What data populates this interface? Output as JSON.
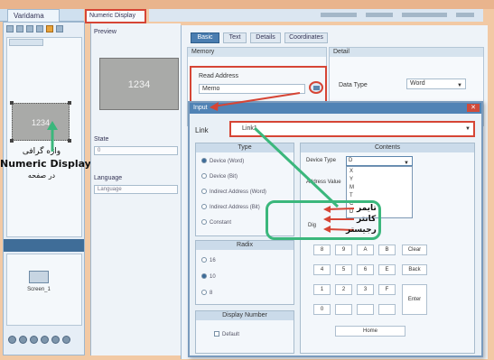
{
  "left_tab": "Varidama",
  "numeric_tab": "Numeric Display",
  "left_pane": {
    "widget_value": "1234",
    "annotation": [
      "واژه گرافی",
      "Numeric Display",
      "در صفحه"
    ],
    "thumb_label": "Screen_1"
  },
  "props": {
    "preview_label": "Preview",
    "preview_value": "1234",
    "fields": [
      {
        "label": "State",
        "value": "0"
      },
      {
        "label": "Language",
        "value": "Language"
      }
    ]
  },
  "dialog": {
    "tabs": [
      "Basic",
      "Text",
      "Details",
      "Coordinates"
    ],
    "memory_label": "Memory",
    "read_address_label": "Read Address",
    "read_address_value": "Memo",
    "detail_label": "Detail",
    "data_type_label": "Data Type",
    "data_type_value": "Word"
  },
  "input_dialog": {
    "title": "Input",
    "link_label": "Link",
    "link_value": "Link1",
    "type_title": "Type",
    "type_options": [
      "Device (Word)",
      "Device (Bit)",
      "Indirect Address (Word)",
      "Indirect Address (Bit)",
      "Constant"
    ],
    "radix_title": "Radix",
    "radix_options": [
      "16",
      "10",
      "8"
    ],
    "format_title": "Display Number",
    "default_label": "Default",
    "contents_title": "Contents",
    "device_type_label": "Device Type",
    "device_type_value": "D",
    "device_list": [
      "X",
      "Y",
      "M",
      "T",
      "C",
      "D"
    ],
    "address_label": "Address Value",
    "decimal_label": "Dig",
    "keys": [
      [
        "8",
        "9",
        "A",
        "B",
        "Clear"
      ],
      [
        "4",
        "5",
        "6",
        "E",
        "Back"
      ],
      [
        "1",
        "2",
        "3",
        "F",
        ""
      ],
      [
        "0",
        "",
        "",
        "",
        ""
      ]
    ],
    "key_enter": "Enter",
    "key_home": "Home"
  },
  "annotations": {
    "timer": "تایمر",
    "counter": "کانتر",
    "register": "رجیستر"
  }
}
